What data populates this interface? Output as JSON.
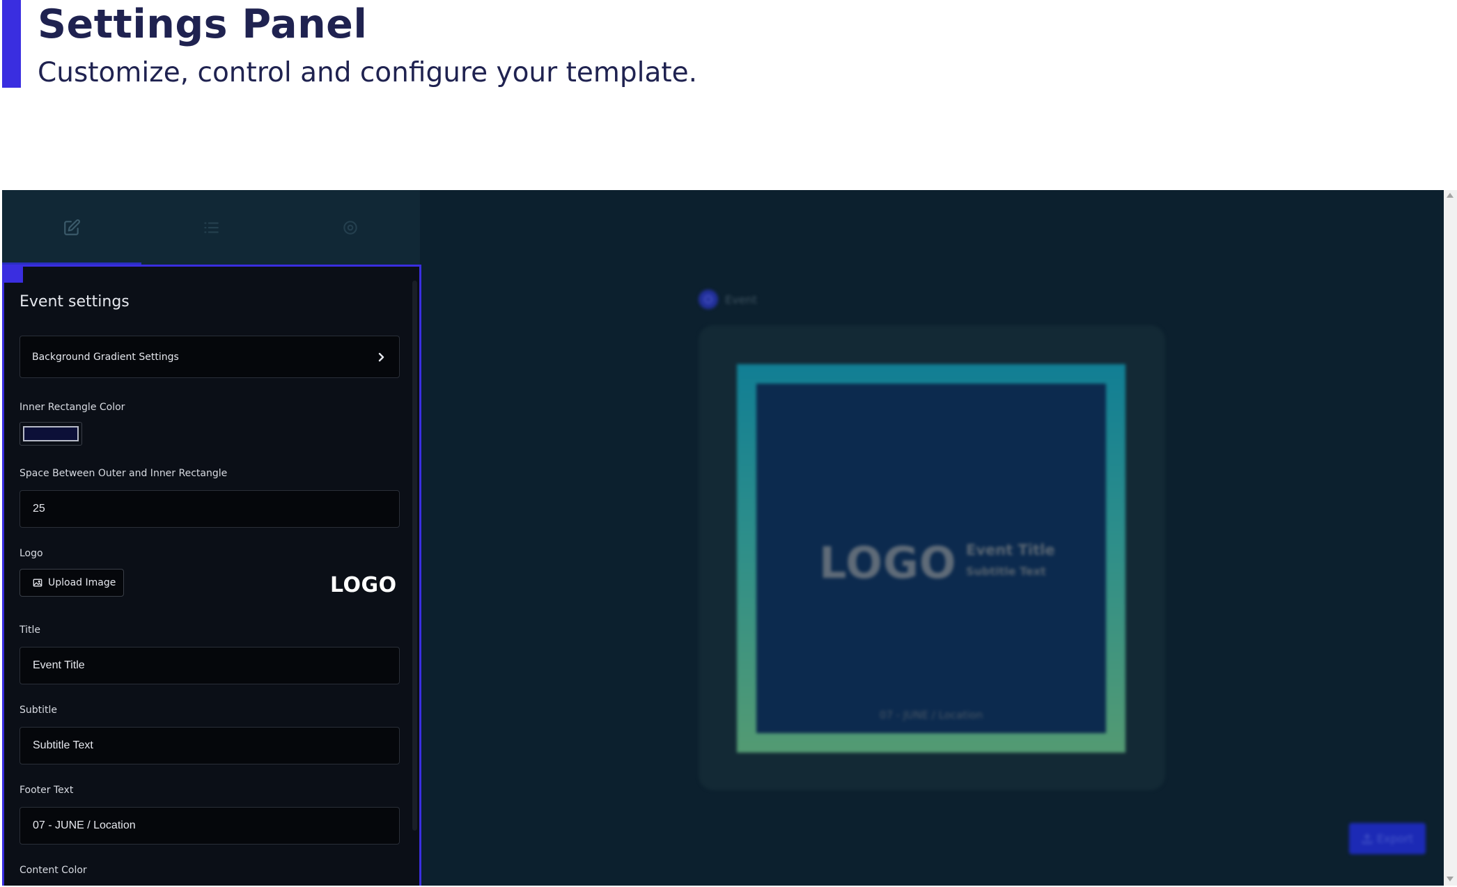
{
  "slide": {
    "title": "Settings Panel",
    "subtitle": "Customize, control and configure your template."
  },
  "tabs": [
    {
      "icon": "edit-icon",
      "active": true
    },
    {
      "icon": "list-icon",
      "active": false
    },
    {
      "icon": "gear-icon",
      "active": false
    }
  ],
  "panel": {
    "heading": "Event settings",
    "gradient_button_label": "Background Gradient Settings",
    "inner_rect_label": "Inner Rectangle Color",
    "inner_rect_color": "#0c1038",
    "spacing_label": "Space Between Outer and Inner Rectangle",
    "spacing_value": "25",
    "logo_label": "Logo",
    "upload_label": "Upload Image",
    "logo_preview": "LOGO",
    "title_label": "Title",
    "title_value": "Event Title",
    "subtitle_label": "Subtitle",
    "subtitle_value": "Subtitle Text",
    "footer_label": "Footer Text",
    "footer_value": "07 - JUNE / Location",
    "content_color_label": "Content Color"
  },
  "preview": {
    "event_label": "Event",
    "logo": "LOGO",
    "title": "Event Title",
    "subtitle": "Subtitle Text",
    "footer": "07 - JUNE / Location",
    "export_label": "Export"
  },
  "colors": {
    "accent": "#3a2ee0",
    "sidebar_bg": "#0e1720",
    "canvas_bg": "#0c202e",
    "gradient_top": "#117e94",
    "gradient_bottom": "#539a72"
  }
}
